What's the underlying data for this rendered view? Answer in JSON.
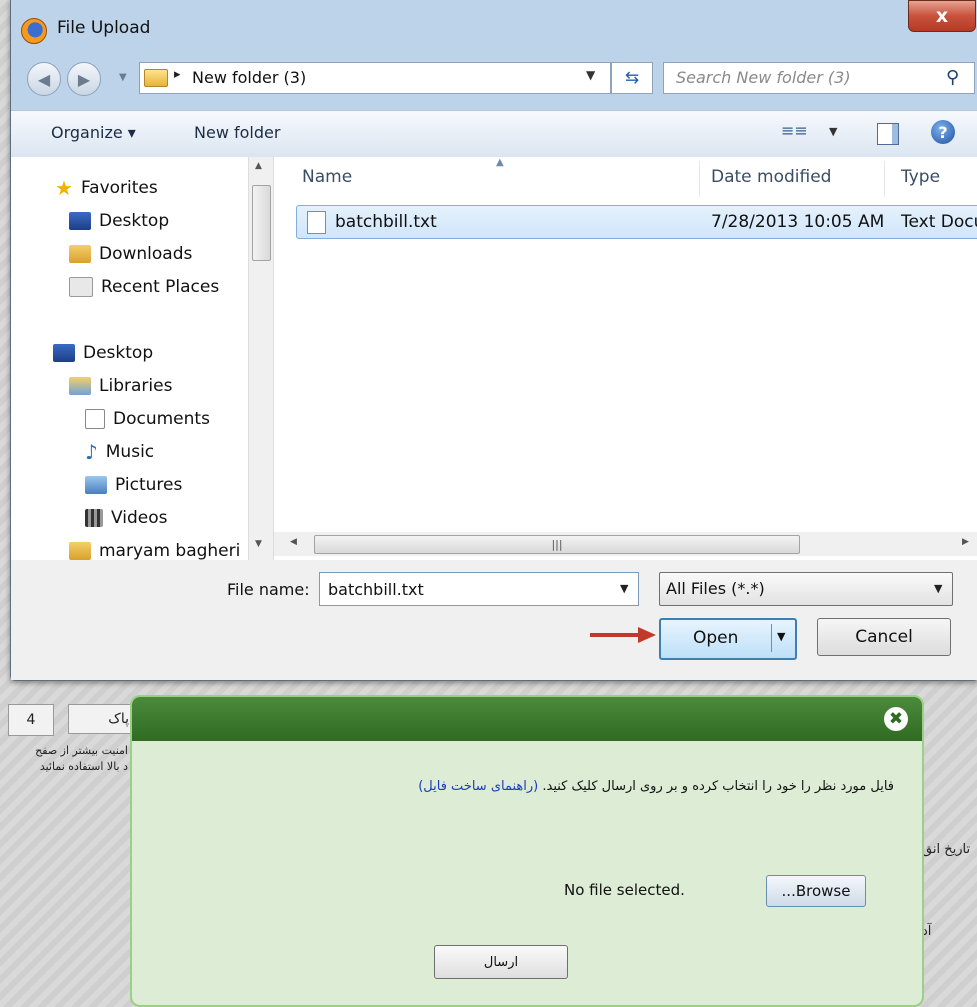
{
  "window": {
    "title": "File Upload",
    "close_glyph": "x"
  },
  "address": {
    "path": "New folder (3)",
    "separator": "▸",
    "search_placeholder": "Search New folder (3)"
  },
  "toolbar": {
    "organize": "Organize ▾",
    "new_folder": "New folder",
    "views_glyph": "≡≡",
    "help_glyph": "?"
  },
  "nav": {
    "favorites": {
      "label": "Favorites",
      "items": [
        "Desktop",
        "Downloads",
        "Recent Places"
      ]
    },
    "desktop": "Desktop",
    "libraries": {
      "label": "Libraries",
      "items": [
        "Documents",
        "Music",
        "Pictures",
        "Videos"
      ]
    },
    "user": "maryam bagheri"
  },
  "columns": {
    "name": "Name",
    "date": "Date modified",
    "type": "Type"
  },
  "files": [
    {
      "name": "batchbill.txt",
      "date": "7/28/2013 10:05 AM",
      "type": "Text Docu"
    }
  ],
  "bottom": {
    "filename_label": "File name:",
    "filename_value": "batchbill.txt",
    "filter_value": "All Files (*.*)",
    "open_label": "Open",
    "cancel_label": "Cancel"
  },
  "background": {
    "field_value": "4",
    "field_label": "پاک",
    "note_line1": "امنیت بیشتر از صفح",
    "note_line2": "د بالا استفاده نمائید",
    "date_label": "تاریخ انق",
    "amount_label": "آد"
  },
  "modal": {
    "message": "فایل مورد نظر را خود را انتخاب کرده و بر روی ارسال کلیک کنید.",
    "help_link": "(راهنمای ساخت فایل)",
    "no_file": "No file selected.",
    "browse_label": "...Browse",
    "submit_label": "ارسال",
    "close_glyph": "✖"
  },
  "colors": {
    "dialog_frame": "#bcd3ea",
    "modal_header": "#2f6b22",
    "modal_body": "#dcecd5",
    "link": "#1d3bbf",
    "arrow": "#c0392b"
  }
}
